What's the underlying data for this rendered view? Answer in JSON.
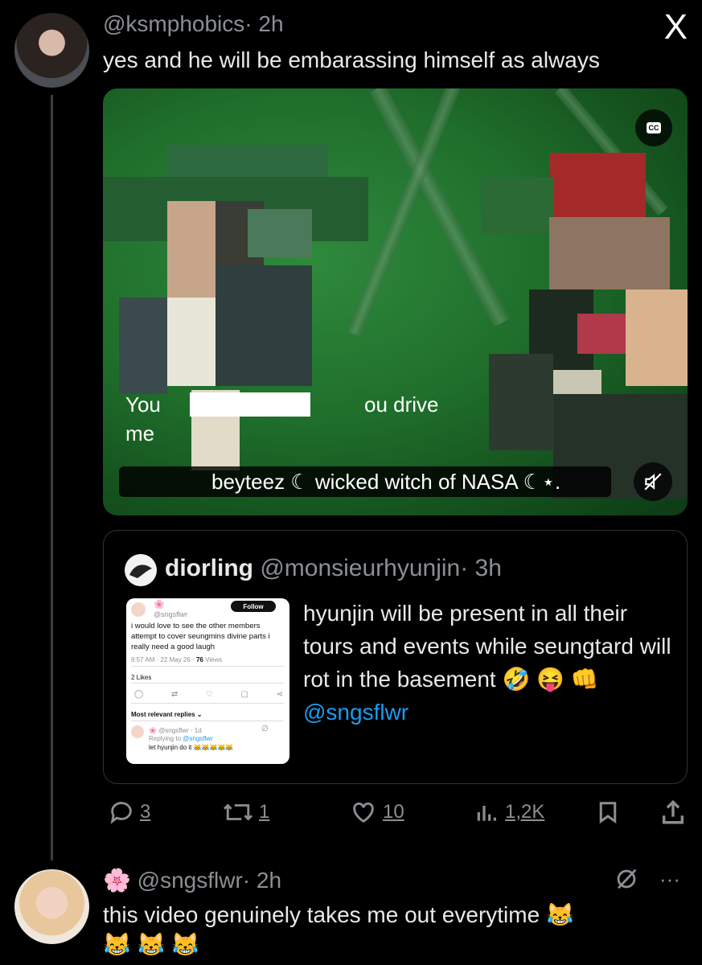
{
  "close_label": "X",
  "tweet": {
    "handle": "@ksmphobics",
    "time": "· 2h",
    "text": "yes and he will be embarassing himself as always"
  },
  "video": {
    "cc_label": "CC",
    "caption_line1a": "You",
    "caption_line1b": "ou drive",
    "caption_line2": "me",
    "watermark": "beyteez ☾ wicked witch of NASA ☾⋆."
  },
  "quote": {
    "name": "diorling",
    "handle": "@monsieurhyunjin",
    "time": "· 3h",
    "text": "hyunjin will be present in all their tours and events while seungtard will rot in the basement 🤣 😝 👊",
    "mention": "@sngsflwr",
    "embed": {
      "handle": "@sngsflwr",
      "follow_label": "Follow",
      "text": "i would love to see the other members attempt to cover seungmins divine parts i really need a good laugh",
      "meta": "9:57 AM · 22 May 26 ·",
      "views_count": "76",
      "views_label": "Views",
      "likes": "2 Likes",
      "replies_label": "Most relevant replies ⌄",
      "reply_handle": "@sngsflwr · 1d",
      "reply_to": "Replying to",
      "reply_to_handle": "@sngsflwr",
      "reply_text": "let hyunjin do it 😹😹😹😹😹"
    }
  },
  "actions": {
    "replies": "3",
    "retweets": "1",
    "likes": "10",
    "views": "1,2K"
  },
  "reply": {
    "emoji": "🌸",
    "handle": "@sngsflwr",
    "time": "· 2h",
    "more": "···",
    "line1": "this video genuinely takes me out everytime 😹",
    "line2": "😹 😹 😹"
  }
}
